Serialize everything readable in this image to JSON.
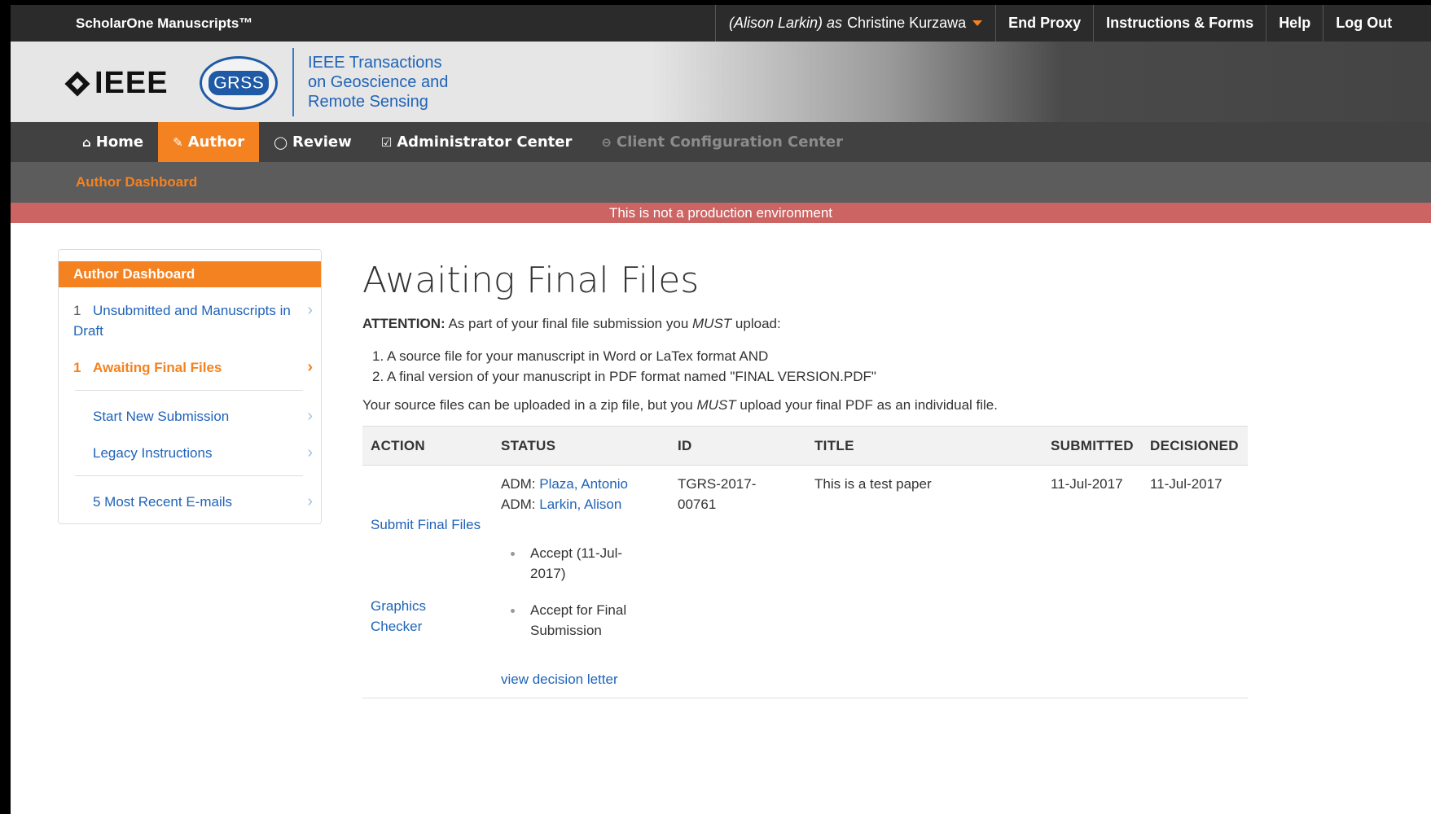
{
  "topbar": {
    "brand": "ScholarOne Manuscripts™",
    "proxy_prefix": "(Alison Larkin) as",
    "proxy_user": "Christine Kurzawa",
    "end_proxy": "End Proxy",
    "instructions": "Instructions & Forms",
    "help": "Help",
    "logout": "Log Out",
    "accent": "#f58220"
  },
  "banner": {
    "ieee": "IEEE",
    "grss": "GRSS",
    "journal_line1": "IEEE Transactions",
    "journal_line2": "on Geoscience and",
    "journal_line3": "Remote Sensing"
  },
  "nav": {
    "home": "Home",
    "author": "Author",
    "review": "Review",
    "admin": "Administrator Center",
    "client": "Client Configuration Center"
  },
  "subnav": {
    "label": "Author Dashboard"
  },
  "env_notice": "This is not a production environment",
  "sidebar": {
    "title": "Author Dashboard",
    "items": [
      {
        "num": "1",
        "label": "Unsubmitted and Manuscripts in Draft"
      },
      {
        "num": "1",
        "label": "Awaiting Final Files"
      },
      {
        "num": "",
        "label": "Start New Submission"
      },
      {
        "num": "",
        "label": "Legacy Instructions"
      },
      {
        "num": "",
        "label": "5 Most Recent E-mails"
      }
    ]
  },
  "main": {
    "title": "Awaiting Final Files",
    "attention_label": "ATTENTION:",
    "attention_text_a": "As part of your final file submission you",
    "attention_must": "MUST",
    "attention_text_b": "upload:",
    "list": [
      "1. A source file for your manuscript in Word or LaTex format AND",
      "2. A final version of your manuscript in PDF format named \"FINAL VERSION.PDF\""
    ],
    "note_a": "Your source files can be uploaded in a zip file, but you",
    "note_must": "MUST",
    "note_b": "upload your final PDF as an individual file.",
    "table": {
      "headers": [
        "ACTION",
        "STATUS",
        "ID",
        "TITLE",
        "SUBMITTED",
        "DECISIONED"
      ],
      "row": {
        "action_submit": "Submit Final Files",
        "action_graphics": "Graphics Checker",
        "adm_prefix": "ADM:",
        "adm1": "Plaza, Antonio",
        "adm2": "Larkin, Alison",
        "status1": "Accept (11-Jul-2017)",
        "status2": "Accept for Final Submission",
        "decision_link": "view decision letter",
        "id": "TGRS-2017-00761",
        "title": "This is a test paper",
        "submitted": "11-Jul-2017",
        "decisioned": "11-Jul-2017"
      }
    }
  }
}
